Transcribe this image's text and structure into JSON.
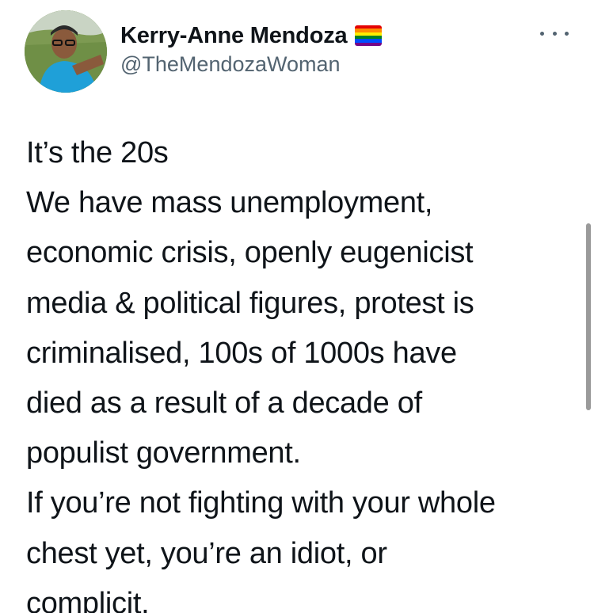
{
  "author": {
    "name": "Kerry-Anne Mendoza",
    "handle": "@TheMendozaWoman",
    "badge_icon": "rainbow-flag-icon",
    "avatar_icon": "profile-photo"
  },
  "menu": {
    "icon": "more-dots-icon"
  },
  "tweet": {
    "lines": [
      "It’s the 20s",
      "We have mass unemployment,",
      "economic crisis, openly eugenicist",
      "media & political figures, protest is",
      "criminalised, 100s of 1000s have",
      "died as a result of a decade of",
      "populist government.",
      "If you’re not fighting with your whole",
      "chest yet, you’re an idiot, or",
      "complicit."
    ]
  },
  "colors": {
    "text": "#0f1419",
    "secondary": "#536471",
    "background": "#ffffff",
    "flag": [
      "#e40303",
      "#ff8c00",
      "#ffed00",
      "#008026",
      "#004dff",
      "#750787"
    ]
  }
}
